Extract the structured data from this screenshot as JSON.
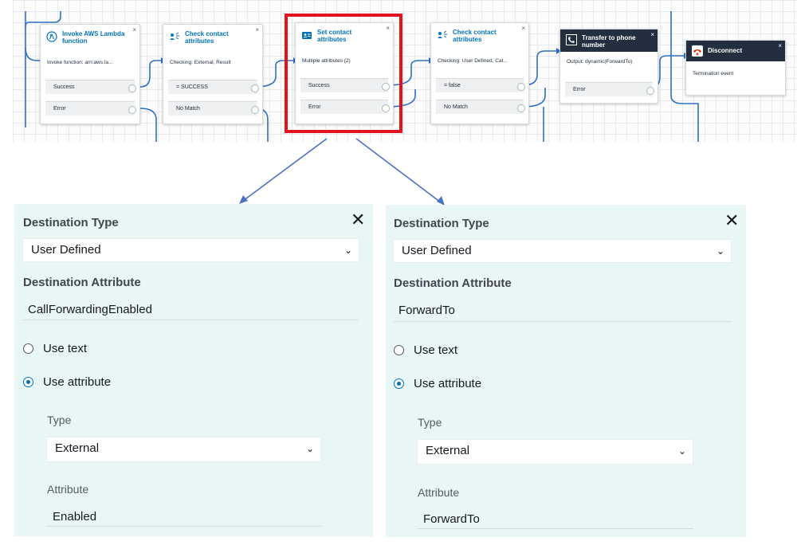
{
  "flow": {
    "blocks": [
      {
        "title": "Invoke AWS Lambda function",
        "subtitle": "Invoke function: arn:aws:la...",
        "branches": [
          "Success",
          "Error"
        ],
        "icon": "lambda-icon"
      },
      {
        "title": "Check contact attributes",
        "subtitle": "Checking: External, Result",
        "branches": [
          "= SUCCESS",
          "No Match"
        ],
        "icon": "contact-check-icon"
      },
      {
        "title": "Set contact attributes",
        "subtitle": "Multiple attributes (2)",
        "branches": [
          "Success",
          "Error"
        ],
        "icon": "contact-card-icon"
      },
      {
        "title": "Check contact attributes",
        "subtitle": "Checking: User Defined, Cal...",
        "branches": [
          "= false",
          "No Match"
        ],
        "icon": "contact-check-icon"
      },
      {
        "title": "Transfer to phone number",
        "subtitle": "Output: dynamic(ForwardTo)",
        "branches": [
          "Error"
        ],
        "icon": "phone-transfer-icon"
      },
      {
        "title": "Disconnect",
        "subtitle": "Termination event",
        "branches": [],
        "icon": "hangup-icon"
      }
    ],
    "close_glyph": "×",
    "highlight_color": "#e1141b"
  },
  "panels": [
    {
      "destination_type_label": "Destination Type",
      "destination_type_value": "User Defined",
      "destination_attribute_label": "Destination Attribute",
      "destination_attribute_value": "CallForwardingEnabled",
      "use_text_label": "Use text",
      "use_attribute_label": "Use attribute",
      "type_label": "Type",
      "type_value": "External",
      "attribute_label": "Attribute",
      "attribute_value": "Enabled",
      "selected_option": "Use attribute"
    },
    {
      "destination_type_label": "Destination Type",
      "destination_type_value": "User Defined",
      "destination_attribute_label": "Destination Attribute",
      "destination_attribute_value": "ForwardTo",
      "use_text_label": "Use text",
      "use_attribute_label": "Use attribute",
      "type_label": "Type",
      "type_value": "External",
      "attribute_label": "Attribute",
      "attribute_value": "ForwardTo",
      "selected_option": "Use attribute"
    }
  ],
  "icons": {
    "close": "✕",
    "chevron": "⌄"
  },
  "colors": {
    "accent": "#0073bb",
    "panel_bg": "#e9f6f6",
    "connector": "#2e6fc8"
  }
}
